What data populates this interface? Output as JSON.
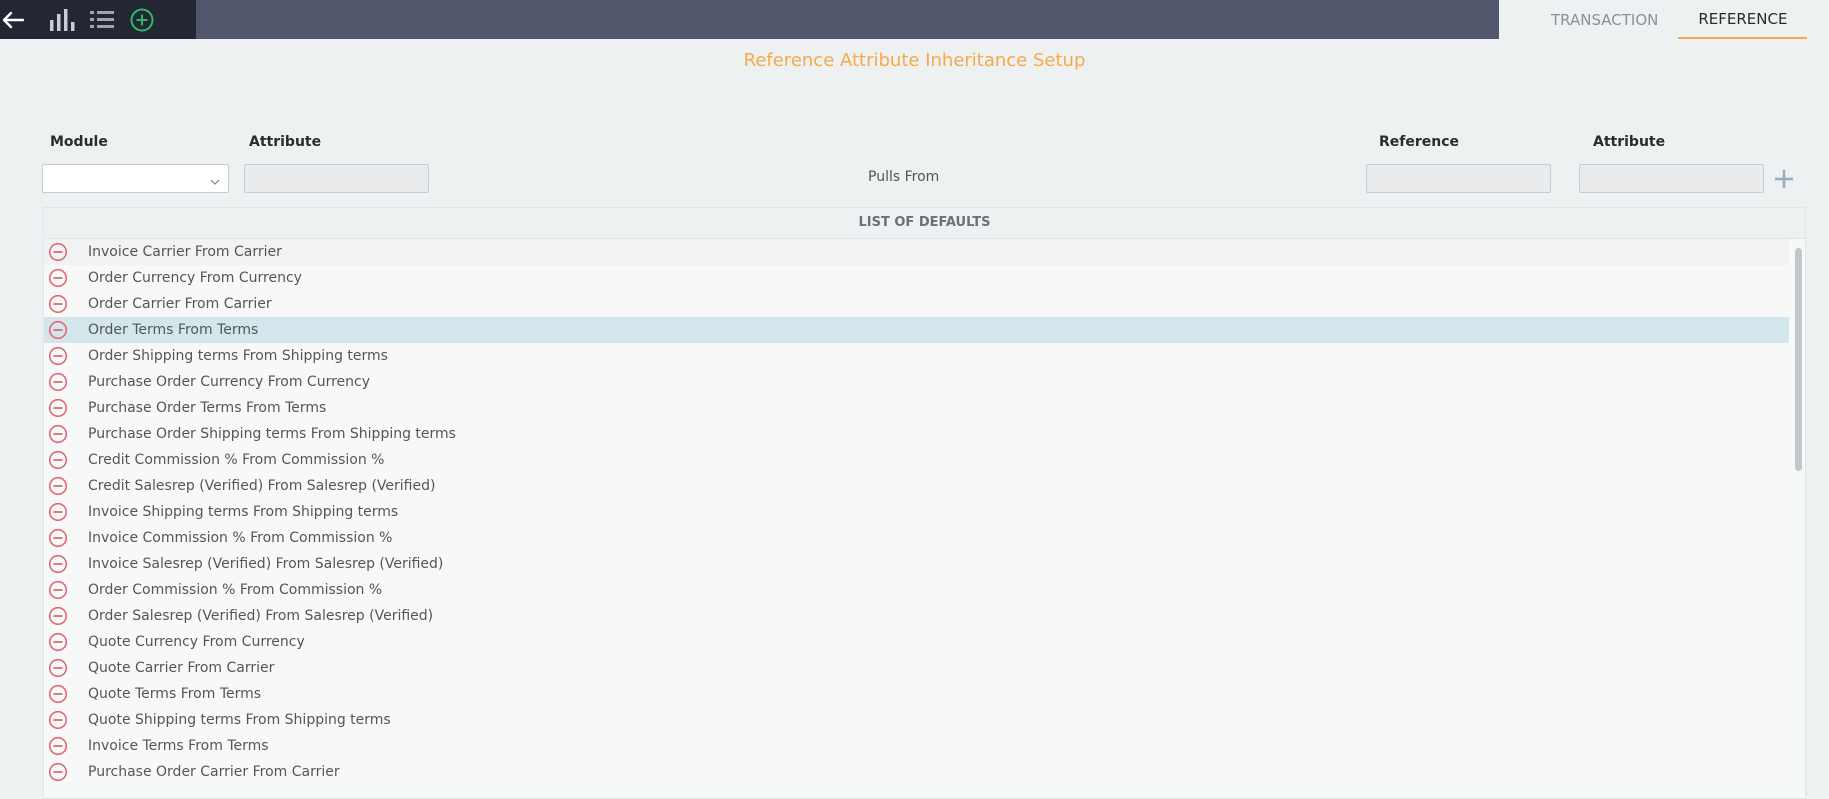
{
  "toolbar": {
    "icons": [
      "back-arrow-icon",
      "bar-chart-icon",
      "list-icon",
      "add-circle-icon"
    ]
  },
  "tabs": [
    {
      "label": "TRANSACTION",
      "active": false
    },
    {
      "label": "REFERENCE",
      "active": true
    }
  ],
  "title": "Reference Attribute Inheritance Setup",
  "form": {
    "module_label": "Module",
    "attribute_label": "Attribute",
    "pulls_from": "Pulls From",
    "reference_label": "Reference",
    "ref_attribute_label": "Attribute",
    "module_value": "",
    "attribute_value": "",
    "reference_value": "",
    "ref_attribute_value": ""
  },
  "list": {
    "header": "LIST OF DEFAULTS",
    "selected_index": 3,
    "items": [
      "Invoice Carrier From Carrier",
      "Order Currency From Currency",
      "Order Carrier From Carrier",
      "Order Terms From Terms",
      "Order Shipping terms From Shipping terms",
      "Purchase Order Currency From Currency",
      "Purchase Order Terms From Terms",
      "Purchase Order Shipping terms From Shipping terms",
      "Credit Commission % From Commission %",
      "Credit Salesrep (Verified) From Salesrep (Verified)",
      "Invoice Shipping terms From Shipping terms",
      "Invoice Commission % From Commission %",
      "Invoice Salesrep (Verified) From Salesrep (Verified)",
      "Order Commission % From Commission %",
      "Order Salesrep (Verified) From Salesrep (Verified)",
      "Quote Currency From Currency",
      "Quote Carrier From Carrier",
      "Quote Terms From Terms",
      "Quote Shipping terms From Shipping terms",
      "Invoice Terms From Terms",
      "Purchase Order Carrier From Carrier"
    ]
  },
  "colors": {
    "accent": "#f5a94a",
    "remove_icon": "#e06a74",
    "add_icon_green": "#2fb86b",
    "selected_row": "#d3e6ec"
  }
}
